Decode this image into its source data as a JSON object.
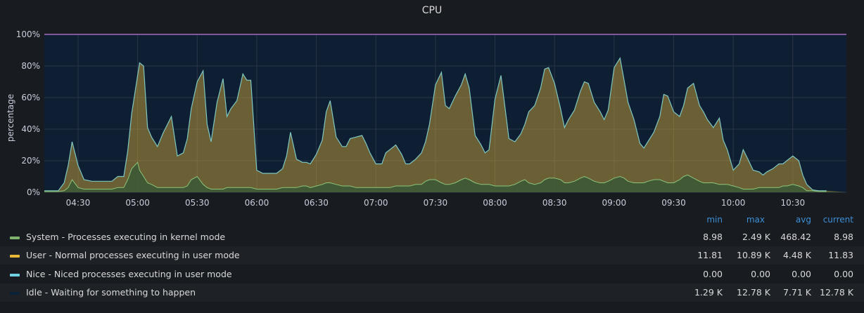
{
  "chart_data": {
    "type": "area",
    "title": "CPU",
    "ylabel": "percentage",
    "xlabel": "",
    "ylim": [
      0,
      100
    ],
    "y_ticks": [
      "0%",
      "20%",
      "40%",
      "60%",
      "80%",
      "100%"
    ],
    "x_ticks": [
      "04:30",
      "05:00",
      "05:30",
      "06:00",
      "06:30",
      "07:00",
      "07:30",
      "08:00",
      "08:30",
      "09:00",
      "09:30",
      "10:00",
      "10:30"
    ],
    "stacked": true,
    "grid": true,
    "x": [
      "04:13",
      "04:17",
      "04:20",
      "04:23",
      "04:25",
      "04:27",
      "04:30",
      "04:33",
      "04:37",
      "04:40",
      "04:43",
      "04:47",
      "04:50",
      "04:53",
      "04:55",
      "04:57",
      "05:00",
      "05:01",
      "05:03",
      "05:05",
      "05:07",
      "05:10",
      "05:13",
      "05:15",
      "05:17",
      "05:20",
      "05:23",
      "05:25",
      "05:27",
      "05:30",
      "05:33",
      "05:35",
      "05:37",
      "05:40",
      "05:43",
      "05:45",
      "05:47",
      "05:50",
      "05:53",
      "05:55",
      "05:57",
      "06:00",
      "06:03",
      "06:07",
      "06:10",
      "06:13",
      "06:15",
      "06:17",
      "06:20",
      "06:23",
      "06:25",
      "06:27",
      "06:30",
      "06:33",
      "06:35",
      "06:37",
      "06:40",
      "06:43",
      "06:45",
      "06:47",
      "06:50",
      "06:53",
      "06:55",
      "06:57",
      "07:00",
      "07:03",
      "07:05",
      "07:07",
      "07:10",
      "07:13",
      "07:15",
      "07:17",
      "07:20",
      "07:23",
      "07:25",
      "07:27",
      "07:30",
      "07:33",
      "07:35",
      "07:37",
      "07:40",
      "07:43",
      "07:45",
      "07:47",
      "07:50",
      "07:53",
      "07:55",
      "07:57",
      "08:00",
      "08:03",
      "08:05",
      "08:07",
      "08:10",
      "08:13",
      "08:15",
      "08:17",
      "08:20",
      "08:23",
      "08:25",
      "08:27",
      "08:30",
      "08:33",
      "08:35",
      "08:37",
      "08:40",
      "08:43",
      "08:45",
      "08:47",
      "08:50",
      "08:53",
      "08:55",
      "08:57",
      "09:00",
      "09:03",
      "09:05",
      "09:07",
      "09:10",
      "09:13",
      "09:15",
      "09:17",
      "09:20",
      "09:23",
      "09:25",
      "09:27",
      "09:30",
      "09:33",
      "09:35",
      "09:37",
      "09:40",
      "09:43",
      "09:45",
      "09:47",
      "09:50",
      "09:53",
      "09:55",
      "09:57",
      "10:00",
      "10:03",
      "10:05",
      "10:07",
      "10:10",
      "10:13",
      "10:15",
      "10:17",
      "10:20",
      "10:23",
      "10:25",
      "10:27",
      "10:30",
      "10:33",
      "10:35",
      "10:37",
      "10:40",
      "10:43",
      "10:45",
      "10:47",
      "10:50",
      "10:53",
      "10:55",
      "10:57"
    ],
    "series": [
      {
        "name": "System - Processes executing in kernel mode",
        "color": "#7eb26d",
        "values": [
          0.5,
          0.5,
          0.5,
          1,
          3,
          8,
          3,
          2,
          2,
          2,
          2,
          2,
          3,
          3,
          8,
          15,
          19,
          14,
          10,
          6,
          5,
          3,
          3,
          3,
          3,
          3,
          3,
          4,
          8,
          10,
          5,
          3,
          2,
          2,
          2,
          3,
          3,
          3,
          3,
          3,
          3,
          2,
          2,
          2,
          2,
          3,
          3,
          3,
          3,
          4,
          4,
          3,
          4,
          5,
          6,
          6,
          5,
          4,
          4,
          4,
          3,
          3,
          3,
          3,
          3,
          3,
          3,
          3,
          4,
          4,
          4,
          4,
          5,
          5,
          7,
          8,
          8,
          6,
          5,
          5,
          6,
          8,
          9,
          8,
          6,
          5,
          5,
          5,
          4,
          4,
          4,
          4,
          5,
          7,
          8,
          6,
          5,
          6,
          8,
          9,
          9,
          8,
          6,
          6,
          7,
          9,
          10,
          9,
          7,
          6,
          6,
          7,
          9,
          10,
          9,
          7,
          6,
          6,
          6,
          7,
          8,
          8,
          7,
          6,
          6,
          8,
          10,
          11,
          9,
          7,
          6,
          6,
          6,
          5,
          5,
          5,
          4,
          3,
          2,
          2,
          2,
          3,
          3,
          3,
          3,
          3,
          4,
          4,
          5,
          4,
          3,
          1,
          1,
          0.5,
          0.5,
          0.5
        ]
      },
      {
        "name": "User - Normal processes executing in user mode",
        "color": "#eab839",
        "values": [
          0.5,
          0.5,
          0.5,
          5,
          14,
          24,
          14,
          6,
          5,
          5,
          5,
          5,
          7,
          7,
          18,
          35,
          55,
          68,
          70,
          35,
          30,
          26,
          35,
          40,
          45,
          20,
          22,
          30,
          45,
          60,
          72,
          40,
          30,
          55,
          70,
          45,
          50,
          55,
          72,
          68,
          68,
          12,
          10,
          10,
          10,
          12,
          20,
          35,
          18,
          15,
          15,
          15,
          20,
          28,
          45,
          52,
          30,
          25,
          25,
          30,
          32,
          33,
          28,
          22,
          15,
          15,
          22,
          24,
          26,
          20,
          14,
          14,
          16,
          20,
          25,
          35,
          60,
          70,
          50,
          48,
          55,
          60,
          66,
          58,
          30,
          25,
          20,
          22,
          55,
          70,
          50,
          30,
          27,
          30,
          35,
          45,
          50,
          60,
          70,
          70,
          60,
          45,
          35,
          40,
          45,
          55,
          60,
          60,
          50,
          45,
          40,
          45,
          70,
          75,
          62,
          50,
          40,
          25,
          22,
          25,
          30,
          40,
          55,
          55,
          45,
          40,
          45,
          55,
          60,
          48,
          45,
          40,
          35,
          42,
          28,
          22,
          10,
          15,
          25,
          20,
          12,
          10,
          8,
          10,
          12,
          15,
          14,
          16,
          18,
          16,
          8,
          4,
          0.5,
          0.5,
          0.5,
          0.5
        ]
      },
      {
        "name": "Nice - Niced processes executing in user mode",
        "color": "#6ed0e0",
        "values": [
          0,
          0,
          0,
          0,
          0,
          0,
          0,
          0,
          0,
          0,
          0,
          0,
          0,
          0,
          0,
          0,
          0,
          0,
          0,
          0,
          0,
          0,
          0,
          0,
          0,
          0,
          0,
          0,
          0,
          0,
          0,
          0,
          0,
          0,
          0,
          0,
          0,
          0,
          0,
          0,
          0,
          0,
          0,
          0,
          0,
          0,
          0,
          0,
          0,
          0,
          0,
          0,
          0,
          0,
          0,
          0,
          0,
          0,
          0,
          0,
          0,
          0,
          0,
          0,
          0,
          0,
          0,
          0,
          0,
          0,
          0,
          0,
          0,
          0,
          0,
          0,
          0,
          0,
          0,
          0,
          0,
          0,
          0,
          0,
          0,
          0,
          0,
          0,
          0,
          0,
          0,
          0,
          0,
          0,
          0,
          0,
          0,
          0,
          0,
          0,
          0,
          0,
          0,
          0,
          0,
          0,
          0,
          0,
          0,
          0,
          0,
          0,
          0,
          0,
          0,
          0,
          0,
          0,
          0,
          0,
          0,
          0,
          0,
          0,
          0,
          0,
          0,
          0,
          0,
          0,
          0,
          0,
          0,
          0,
          0,
          0,
          0,
          0,
          0,
          0,
          0,
          0,
          0,
          0,
          0,
          0,
          0,
          0,
          0,
          0,
          0,
          0,
          0,
          0,
          0,
          0
        ]
      },
      {
        "name": "Idle - Waiting for something to happen",
        "color": "#0a2238"
      }
    ],
    "legend": {
      "placement": "bottom",
      "columns": [
        "min",
        "max",
        "avg",
        "current"
      ],
      "rows": [
        {
          "label": "System - Processes executing in kernel mode",
          "color": "#7eb26d",
          "min": "8.98",
          "max": "2.49 K",
          "avg": "468.42",
          "current": "8.98"
        },
        {
          "label": "User - Normal processes executing in user mode",
          "color": "#eab839",
          "min": "11.81",
          "max": "10.89 K",
          "avg": "4.48 K",
          "current": "11.83"
        },
        {
          "label": "Nice - Niced processes executing in user mode",
          "color": "#6ed0e0",
          "min": "0.00",
          "max": "0.00",
          "avg": "0.00",
          "current": "0.00"
        },
        {
          "label": "Idle - Waiting for something to happen",
          "color": "#0a2238",
          "min": "1.29 K",
          "max": "12.78 K",
          "avg": "7.71 K",
          "current": "12.78 K"
        }
      ]
    }
  }
}
